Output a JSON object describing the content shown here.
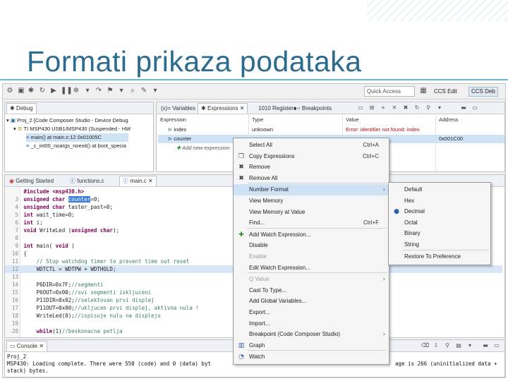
{
  "slide": {
    "title": "Formati prikaza podataka"
  },
  "toolbar": {
    "quick_access": "Quick Access",
    "perspectives": [
      "CCS Edit",
      "CCS Deb"
    ]
  },
  "debug_panel": {
    "tab": "Debug",
    "rows": [
      "Proj_2 [Code Composer Studio - Device Debug",
      "TI MSP430 USB1/MSP430 (Suspended - HW",
      "main() at main.c:12 0x01005C",
      "_c_int00_noargs_noexit() at boot_specia"
    ]
  },
  "variables_panel": {
    "tabs": [
      "Variables",
      "Expressions",
      "Registers",
      "Breakpoints"
    ],
    "columns": [
      "Expression",
      "Type",
      "Value",
      "Address"
    ],
    "rows": [
      {
        "expression": "index",
        "type": "unknown",
        "value": "Error: identifier not found: index",
        "address": ""
      },
      {
        "expression": "counter",
        "type": "",
        "value": "",
        "address": "0x001C00"
      },
      {
        "expression": "Add new expression",
        "type": "",
        "value": "",
        "address": ""
      }
    ]
  },
  "editor": {
    "tabs": [
      "Getting Started",
      "functions.c",
      "main.c"
    ],
    "lines": [
      {
        "n": "",
        "text": "#include <msp430.h>"
      },
      {
        "n": "3",
        "text": "unsigned char counter=0;"
      },
      {
        "n": "4",
        "text": "unsigned char taster_past=0;"
      },
      {
        "n": "5",
        "text": "int wait_time=0;"
      },
      {
        "n": "6",
        "text": "int i;"
      },
      {
        "n": "7",
        "text": "void WriteLed (unsigned char);"
      },
      {
        "n": "8",
        "text": ""
      },
      {
        "n": "9",
        "text": "int main( void )"
      },
      {
        "n": "10",
        "text": "{"
      },
      {
        "n": "11",
        "text": "    // Stop watchdog timer to prevent time out reset"
      },
      {
        "n": "12",
        "text": "    WDTCTL = WDTPW + WDTHOLD;"
      },
      {
        "n": "13",
        "text": ""
      },
      {
        "n": "14",
        "text": "    P6DIR=0x7F;//segmenti"
      },
      {
        "n": "15",
        "text": "    P6OUT=0x00;//svi segmenti iskljuceni"
      },
      {
        "n": "16",
        "text": "    P11DIR=0x02;//selektovan prvi displej"
      },
      {
        "n": "17",
        "text": "    P11OUT=0x00;//ukljucen prvi displej, aktivna nula !"
      },
      {
        "n": "18",
        "text": "    WriteLed(0);//ispisuje nulu na displeju"
      },
      {
        "n": "19",
        "text": ""
      },
      {
        "n": "20",
        "text": "    while(1)//beskonacna petlja"
      }
    ]
  },
  "console_panel": {
    "tab": "Console",
    "project": "Proj_2",
    "line1_left": "MSP430: Loading complete. There were 550 (code) and 0 (data) byt",
    "line1_right": "age is 266 (uninitialized data +",
    "line2": "stack) bytes."
  },
  "context_menu": {
    "items": [
      {
        "label": "Select All",
        "accel": "Ctrl+A",
        "icon": "",
        "disabled": false
      },
      {
        "label": "Copy Expressions",
        "accel": "Ctrl+C",
        "icon": "copy-icon",
        "disabled": false
      },
      {
        "label": "Remove",
        "accel": "",
        "icon": "remove-icon",
        "disabled": false
      },
      {
        "label": "Remove All",
        "accel": "",
        "icon": "remove-all-icon",
        "disabled": false
      },
      {
        "label": "Number Format",
        "accel": "",
        "icon": "",
        "disabled": false,
        "submenu": true,
        "highlighted": true
      },
      {
        "label": "View Memory",
        "accel": "",
        "icon": "",
        "disabled": false
      },
      {
        "label": "View Memory at Value",
        "accel": "",
        "icon": "",
        "disabled": false
      },
      {
        "label": "Find...",
        "accel": "Ctrl+F",
        "icon": "",
        "disabled": false
      },
      {
        "label": "Add Watch Expression...",
        "accel": "",
        "icon": "add-icon",
        "disabled": false
      },
      {
        "label": "Disable",
        "accel": "",
        "icon": "",
        "disabled": false
      },
      {
        "label": "Enable",
        "accel": "",
        "icon": "",
        "disabled": true
      },
      {
        "label": "Edit Watch Expression...",
        "accel": "",
        "icon": "",
        "disabled": false
      },
      {
        "label": "Q Value",
        "accel": "",
        "icon": "",
        "disabled": true,
        "submenu": true
      },
      {
        "label": "Cast To Type...",
        "accel": "",
        "icon": "",
        "disabled": false
      },
      {
        "label": "Add Global Variables...",
        "accel": "",
        "icon": "",
        "disabled": false
      },
      {
        "label": "Export...",
        "accel": "",
        "icon": "",
        "disabled": false
      },
      {
        "label": "Import...",
        "accel": "",
        "icon": "",
        "disabled": false
      },
      {
        "label": "Breakpoint (Code Composer Studio)",
        "accel": "",
        "icon": "",
        "disabled": false,
        "submenu": true
      },
      {
        "label": "Graph",
        "accel": "",
        "icon": "graph-icon",
        "disabled": false
      },
      {
        "label": "Watch",
        "accel": "",
        "icon": "watch-icon",
        "disabled": false
      }
    ]
  },
  "number_format_menu": {
    "items": [
      {
        "label": "Default",
        "checked": false
      },
      {
        "label": "Hex",
        "checked": false
      },
      {
        "label": "Decimal",
        "checked": true
      },
      {
        "label": "Octal",
        "checked": false
      },
      {
        "label": "Binary",
        "checked": false
      },
      {
        "label": "String",
        "checked": false
      },
      {
        "label": "Restore To Preference",
        "checked": false
      }
    ]
  },
  "colors": {
    "title": "#2a6b8f",
    "selection": "#3a7bd5",
    "menu_hot": "#cfe1f5"
  }
}
